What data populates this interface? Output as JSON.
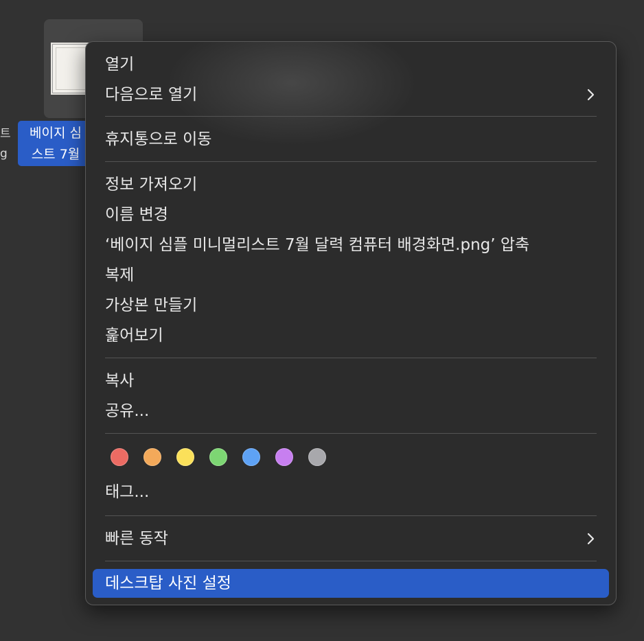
{
  "desktop": {
    "file_label_line1": "베이지 심",
    "file_label_line2": "스트 7월",
    "side_text_line1": "트",
    "side_text_line2": "g",
    "colors": {
      "desktop_bg": "#323232",
      "selection": "#2a5dc7"
    }
  },
  "menu": {
    "groups": [
      {
        "items": [
          {
            "label": "열기"
          },
          {
            "label": "다음으로 열기",
            "submenu_icon": "chevron-right-icon"
          }
        ]
      },
      {
        "items": [
          {
            "label": "휴지통으로 이동"
          }
        ]
      },
      {
        "items": [
          {
            "label": "정보 가져오기"
          },
          {
            "label": "이름 변경"
          },
          {
            "label": "‘베이지 심플 미니멀리스트 7월 달력 컴퓨터 배경화면.png’ 압축"
          },
          {
            "label": "복제"
          },
          {
            "label": "가상본 만들기"
          },
          {
            "label": "훑어보기"
          }
        ]
      },
      {
        "items": [
          {
            "label": "복사"
          },
          {
            "label": "공유..."
          }
        ]
      },
      {
        "items": [
          {
            "label": "태그..."
          }
        ]
      },
      {
        "items": [
          {
            "label": "빠른 동작",
            "submenu_icon": "chevron-right-icon"
          }
        ]
      },
      {
        "items": [
          {
            "label": "데스크탑 사진 설정",
            "highlighted": true
          }
        ]
      }
    ],
    "tag_colors": [
      {
        "name": "red",
        "fill": "#ec6b63",
        "stroke": "#f08a84"
      },
      {
        "name": "orange",
        "fill": "#f3a95a",
        "stroke": "#f6bd7e"
      },
      {
        "name": "yellow",
        "fill": "#fbe05a",
        "stroke": "#fce982"
      },
      {
        "name": "green",
        "fill": "#7dd673",
        "stroke": "#9be193"
      },
      {
        "name": "blue",
        "fill": "#5ea2f5",
        "stroke": "#80b6f7"
      },
      {
        "name": "purple",
        "fill": "#c77ff0",
        "stroke": "#d49cf3"
      },
      {
        "name": "gray",
        "fill": "#a8a8ac",
        "stroke": "#bdbdc0"
      }
    ],
    "colors": {
      "menu_bg": "#2c2c2c",
      "text": "#e8e8e8",
      "separator": "#545454",
      "highlight": "#2a5dc7"
    }
  }
}
